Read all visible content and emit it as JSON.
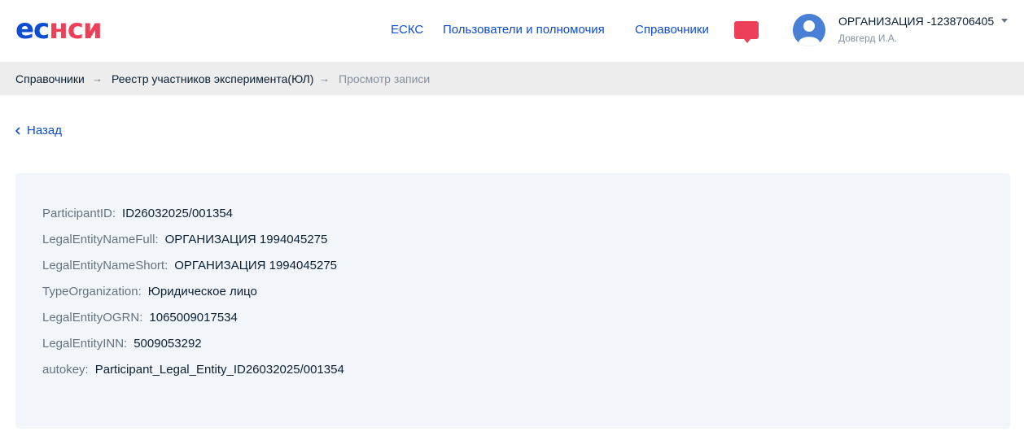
{
  "logo": {
    "part1": "ес",
    "part2": "нси"
  },
  "nav": {
    "eskc": "ЕСКС",
    "users": "Пользователи и полномочия",
    "refs": "Справочники"
  },
  "user": {
    "org": "ОРГАНИЗАЦИЯ -1238706405",
    "name": "Довгерд И.А."
  },
  "breadcrumb": {
    "item1": "Справочники",
    "item2": "Реестр участников эксперимента(ЮЛ)",
    "item3": "Просмотр записи",
    "separator": "→"
  },
  "back": {
    "label": "Назад"
  },
  "record": {
    "rows": [
      {
        "label": "ParticipantID:",
        "value": "ID26032025/001354"
      },
      {
        "label": "LegalEntityNameFull:",
        "value": "ОРГАНИЗАЦИЯ 1994045275"
      },
      {
        "label": "LegalEntityNameShort:",
        "value": "ОРГАНИЗАЦИЯ 1994045275"
      },
      {
        "label": "TypeOrganization:",
        "value": "Юридическое лицо"
      },
      {
        "label": "LegalEntityOGRN:",
        "value": "1065009017534"
      },
      {
        "label": "LegalEntityINN:",
        "value": "5009053292"
      },
      {
        "label": "autokey:",
        "value": "Participant_Legal_Entity_ID26032025/001354"
      }
    ]
  },
  "icons": {
    "chat": "chat-bubble-icon",
    "avatar": "user-avatar-icon",
    "back": "chevron-left-icon",
    "dropdown": "caret-down-icon"
  },
  "colors": {
    "brand_blue": "#0d4cd3",
    "brand_red": "#ee3f58",
    "breadcrumb_bg": "#ededed",
    "card_bg": "#f2f6fa"
  }
}
